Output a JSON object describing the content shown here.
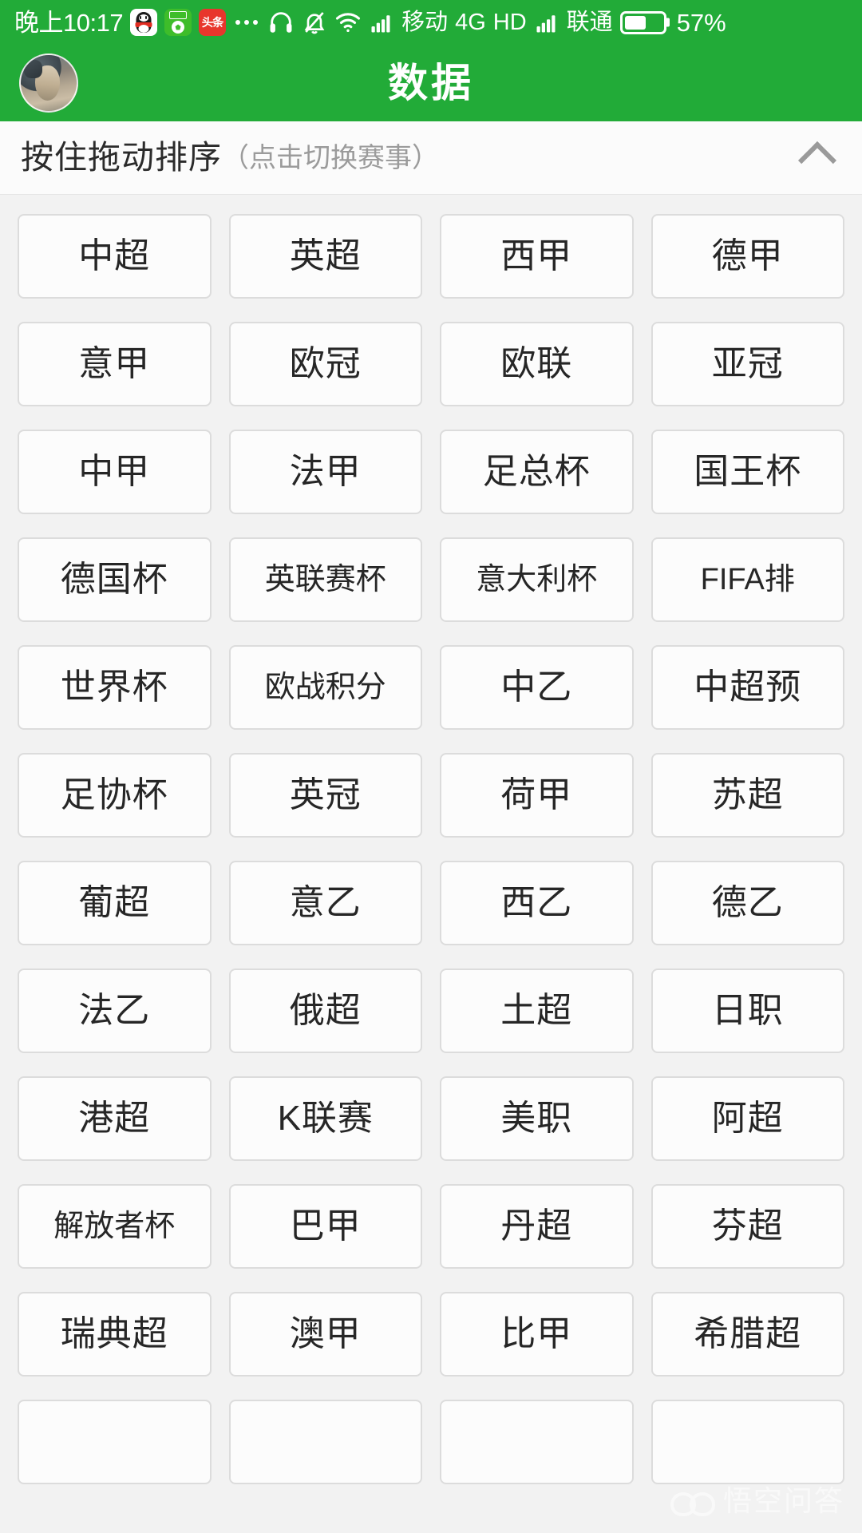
{
  "statusbar": {
    "clock": "晚上10:17",
    "app_icons": [
      {
        "name": "qq-icon",
        "label": ""
      },
      {
        "name": "football-app-icon",
        "label": ""
      },
      {
        "name": "toutiao-icon",
        "label": "头条"
      }
    ],
    "more_dots": "•••",
    "headset_icon": "headset-icon",
    "silent_icon": "bell-muted-icon",
    "wifi_icon": "wifi-icon",
    "signal1_icon": "signal-bars-icon",
    "carrier1": "移动",
    "network": "4G",
    "hd": "HD",
    "signal2_icon": "signal-bars-icon",
    "carrier2": "联通",
    "battery_percent": "57%"
  },
  "titlebar": {
    "title": "数据",
    "avatar_name": "user-avatar"
  },
  "section": {
    "main_label": "按住拖动排序",
    "sub_label": "（点击切换赛事）",
    "collapse_icon": "chevron-up-icon"
  },
  "grid": {
    "tiles": [
      "中超",
      "英超",
      "西甲",
      "德甲",
      "意甲",
      "欧冠",
      "欧联",
      "亚冠",
      "中甲",
      "法甲",
      "足总杯",
      "国王杯",
      "德国杯",
      "英联赛杯",
      "意大利杯",
      "FIFA排",
      "世界杯",
      "欧战积分",
      "中乙",
      "中超预",
      "足协杯",
      "英冠",
      "荷甲",
      "苏超",
      "葡超",
      "意乙",
      "西乙",
      "德乙",
      "法乙",
      "俄超",
      "土超",
      "日职",
      "港超",
      "K联赛",
      "美职",
      "阿超",
      "解放者杯",
      "巴甲",
      "丹超",
      "芬超",
      "瑞典超",
      "澳甲",
      "比甲",
      "希腊超",
      "",
      "",
      "",
      ""
    ]
  },
  "watermark": {
    "text": "悟空问答"
  },
  "colors": {
    "brand_green": "#22ab38",
    "page_bg": "#f2f2f2",
    "tile_bg": "#fcfcfc",
    "tile_border": "#dcdcdc",
    "text_primary": "#262626",
    "text_muted": "#9b9b9b"
  }
}
